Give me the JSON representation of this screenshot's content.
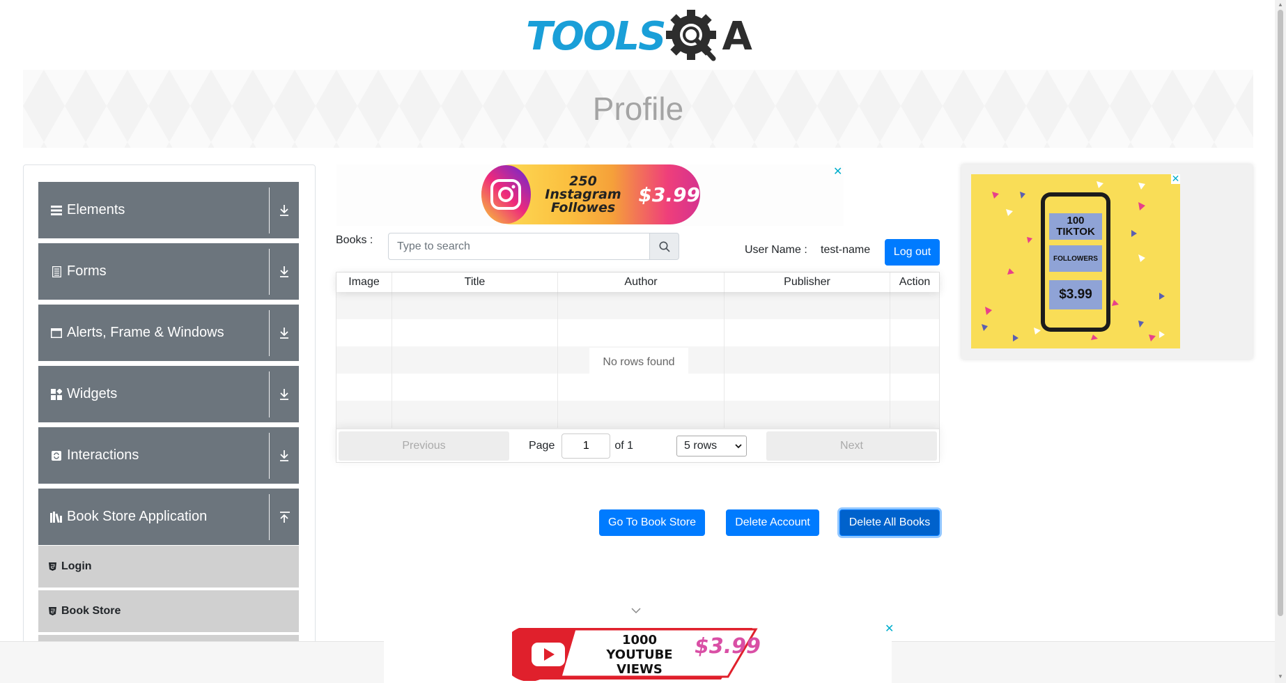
{
  "header": {
    "logo_text": "TOOLS",
    "logo_letter": "A",
    "page_title": "Profile"
  },
  "sidebar": {
    "groups": [
      {
        "label": "Elements",
        "icon": "hamburger-icon",
        "arrow": "down"
      },
      {
        "label": "Forms",
        "icon": "document-icon",
        "arrow": "down"
      },
      {
        "label": "Alerts, Frame & Windows",
        "icon": "window-icon",
        "arrow": "down"
      },
      {
        "label": "Widgets",
        "icon": "widgets-icon",
        "arrow": "down"
      },
      {
        "label": "Interactions",
        "icon": "interactions-icon",
        "arrow": "down"
      },
      {
        "label": "Book Store Application",
        "icon": "books-icon",
        "arrow": "up"
      }
    ],
    "sub_items": [
      {
        "label": "Login"
      },
      {
        "label": "Book Store"
      }
    ]
  },
  "ad_top": {
    "text_line1": "250 Instagram",
    "text_line2": "Followes",
    "price": "$3.99",
    "close": "✕"
  },
  "books": {
    "label": "Books :",
    "search_placeholder": "Type to search",
    "username_label": "User Name :",
    "username_value": "test-name",
    "logout_label": "Log out"
  },
  "table": {
    "columns": [
      "Image",
      "Title",
      "Author",
      "Publisher",
      "Action"
    ],
    "empty_text": "No rows found",
    "pagination": {
      "previous": "Previous",
      "page_label": "Page",
      "page_value": "1",
      "of_label": "of 1",
      "rows_option": "5 rows",
      "next": "Next"
    }
  },
  "actions": {
    "go_to_store": "Go To Book Store",
    "delete_account": "Delete Account",
    "delete_all_books": "Delete All Books"
  },
  "ad_right": {
    "box1": "100 TIKTOK",
    "box2": "FOLLOWERS",
    "box3": "$3.99",
    "close": "✕"
  },
  "ad_bottom": {
    "text_line1": "1000",
    "text_line2": "YOUTUBE VIEWS",
    "price": "$3.99",
    "close": "✕"
  },
  "colors": {
    "primary": "#007bff",
    "sidebar_group": "#6c757d",
    "logo_blue": "#1a9fd8"
  }
}
